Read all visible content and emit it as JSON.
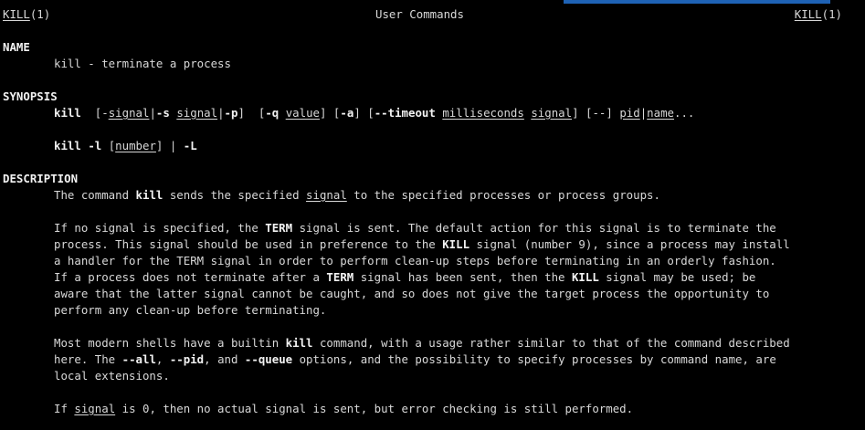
{
  "header": {
    "left_name": "KILL",
    "left_section": "(1)",
    "center": "User Commands",
    "right_name": "KILL",
    "right_section": "(1)"
  },
  "name_section": {
    "heading": "NAME",
    "text": "kill - terminate a process"
  },
  "synopsis": {
    "heading": "SYNOPSIS",
    "line1": {
      "cmd": "kill",
      "sp1": "  [-",
      "signal1": "signal",
      "p1": "|",
      "s_opt": "-s",
      "sp2": " ",
      "signal2": "signal",
      "p2": "|",
      "p_opt": "-p",
      "p3": "]  [",
      "q_opt": "-q",
      "sp3": " ",
      "value": "value",
      "p4": "] [",
      "a_opt": "-a",
      "p5": "] [",
      "timeout_opt": "--timeout",
      "sp4": " ",
      "milliseconds": "milliseconds",
      "sp5": " ",
      "signal3": "signal",
      "p6": "] [--] ",
      "pid": "pid",
      "p7": "|",
      "name": "name",
      "p8": "..."
    },
    "line2": {
      "cmd": "kill",
      "sp1": " ",
      "l_opt": "-l",
      "sp2": " [",
      "number": "number",
      "p1": "] | ",
      "L_opt": "-L"
    }
  },
  "description": {
    "heading": "DESCRIPTION",
    "p1": {
      "t1": "The command ",
      "kill": "kill",
      "t2": " sends the specified ",
      "signal": "signal",
      "t3": " to the specified processes or process groups."
    },
    "p2": {
      "l1_t1": "If no signal is specified, the ",
      "l1_term": "TERM",
      "l1_t2": " signal is sent. The default action for this signal is to terminate the",
      "l2_t1": "process. This signal should be used in preference to the ",
      "l2_kill": "KILL",
      "l2_t2": " signal (number 9), since a process may install",
      "l3": "a handler for the TERM signal in order to perform clean-up steps before terminating in an orderly fashion.",
      "l4_t1": "If a process does not terminate after a ",
      "l4_term": "TERM",
      "l4_t2": " signal has been sent, then the ",
      "l4_kill": "KILL",
      "l4_t3": " signal may be used; be",
      "l5": "aware that the latter signal cannot be caught, and so does not give the target process the opportunity to",
      "l6": "perform any clean-up before terminating."
    },
    "p3": {
      "l1_t1": "Most modern shells have a builtin ",
      "l1_kill": "kill",
      "l1_t2": " command, with a usage rather similar to that of the command described",
      "l2_t1": "here. The ",
      "l2_all": "--all",
      "l2_t2": ", ",
      "l2_pid": "--pid",
      "l2_t3": ", and ",
      "l2_queue": "--queue",
      "l2_t4": " options, and the possibility to specify processes by command name, are",
      "l3": "local extensions."
    },
    "p4": {
      "t1": "If ",
      "signal": "signal",
      "t2": " is 0, then no actual signal is sent, but error checking is still performed."
    }
  }
}
